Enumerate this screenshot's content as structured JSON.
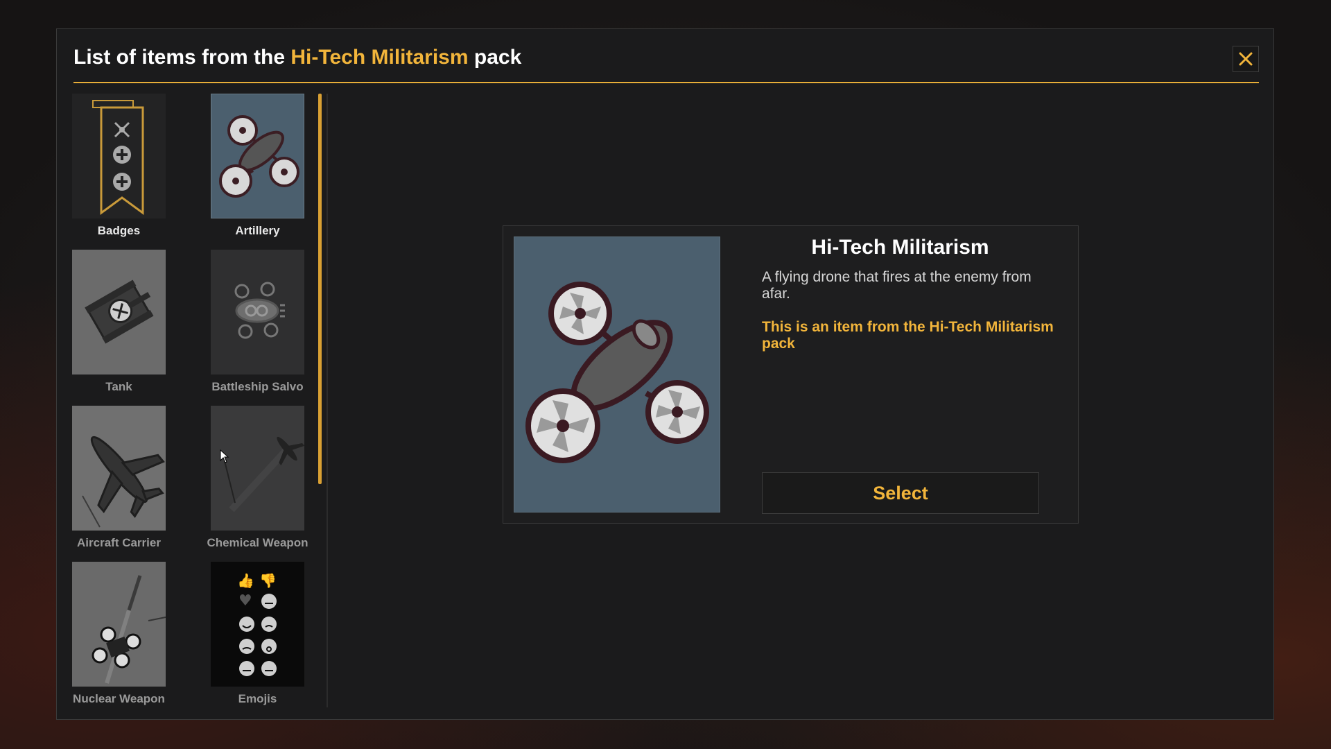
{
  "header": {
    "title_prefix": "List of items from the",
    "pack_name": "Hi-Tech Militarism",
    "title_suffix": "pack",
    "close_icon": "close-icon"
  },
  "items": [
    {
      "label": "Badges",
      "icon": "badge-ribbon-icon"
    },
    {
      "label": "Artillery",
      "icon": "drone-icon"
    },
    {
      "label": "Tank",
      "icon": "tank-icon"
    },
    {
      "label": "Battleship Salvo",
      "icon": "battleship-icon"
    },
    {
      "label": "Aircraft Carrier",
      "icon": "fighter-jet-icon"
    },
    {
      "label": "Chemical Weapon",
      "icon": "chemical-plane-icon"
    },
    {
      "label": "Nuclear Weapon",
      "icon": "nuclear-missile-icon"
    },
    {
      "label": "Emojis",
      "icon": "emojis-icon"
    }
  ],
  "detail": {
    "title": "Hi-Tech Militarism",
    "description": "A flying drone that fires at the enemy from afar.",
    "note": "This is an item from the Hi-Tech Militarism pack",
    "select_label": "Select"
  },
  "colors": {
    "accent": "#f2b53b",
    "panel_bg": "#1b1b1c",
    "preview_bg": "#4b5f6e"
  }
}
